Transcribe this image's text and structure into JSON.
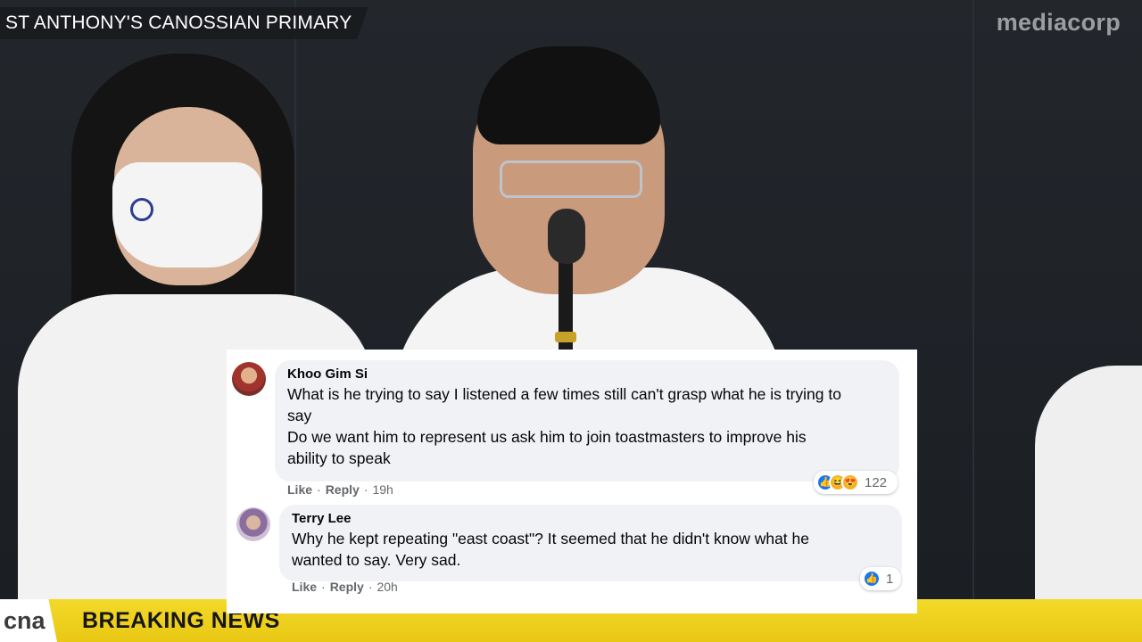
{
  "broadcast": {
    "location": "ST ANTHONY'S CANOSSIAN PRIMARY",
    "watermark": "mediacorp",
    "channel_logo": "cna",
    "ticker": "BREAKING NEWS",
    "ticker_color": "#f3d92a"
  },
  "comments": [
    {
      "author": "Khoo Gim Si",
      "lines": [
        "What is he trying to say I listened a few times still can't grasp what he is trying to",
        "say",
        "Do we want him to represent us ask him to join toastmasters to improve his",
        "ability to speak"
      ],
      "like_label": "Like",
      "reply_label": "Reply",
      "time": "19h",
      "reaction_icons": [
        "like-icon",
        "haha-icon",
        "love-face-icon"
      ],
      "reaction_count": "122"
    },
    {
      "author": "Terry Lee",
      "lines": [
        "Why he kept repeating \"east coast\"? It seemed that he didn't know what he",
        "wanted to say. Very sad."
      ],
      "like_label": "Like",
      "reply_label": "Reply",
      "time": "20h",
      "reaction_icons": [
        "like-icon"
      ],
      "reaction_count": "1"
    }
  ]
}
